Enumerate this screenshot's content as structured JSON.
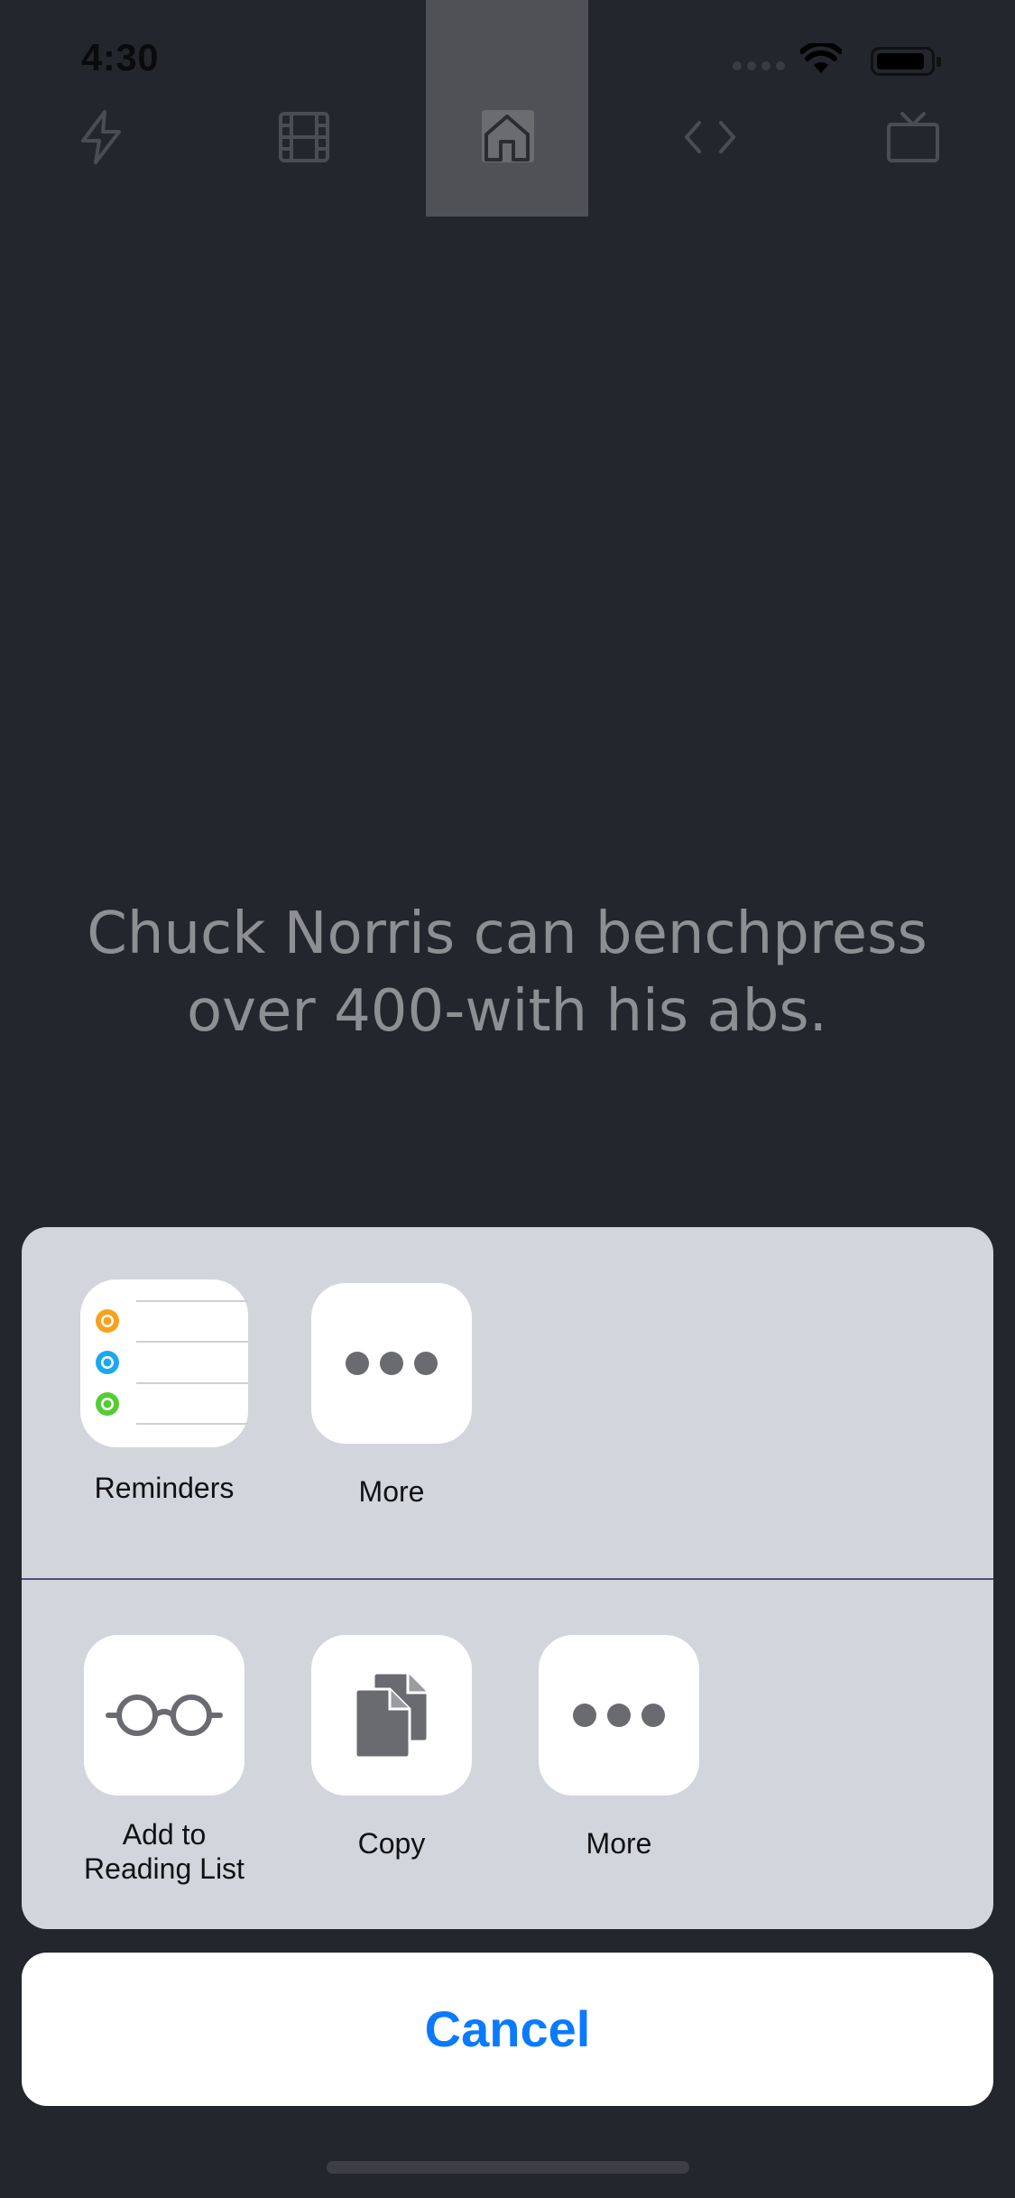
{
  "status_bar": {
    "time": "4:30"
  },
  "tabs": [
    {
      "icon": "lightning-icon",
      "active": false
    },
    {
      "icon": "film-icon",
      "active": false
    },
    {
      "icon": "home-icon",
      "active": true
    },
    {
      "icon": "code-icon",
      "active": false
    },
    {
      "icon": "tv-icon",
      "active": false
    }
  ],
  "joke": {
    "text": "Chuck Norris can benchpress over 400-with his abs."
  },
  "share_sheet": {
    "apps": [
      {
        "label": "Reminders",
        "icon": "reminders-icon"
      },
      {
        "label": "More",
        "icon": "more-icon"
      }
    ],
    "actions": [
      {
        "label": "Add to\nReading List",
        "icon": "glasses-icon"
      },
      {
        "label": "Copy",
        "icon": "copy-icon"
      },
      {
        "label": "More",
        "icon": "more-icon"
      }
    ]
  },
  "cancel_label": "Cancel",
  "colors": {
    "accent": "#0a7aff",
    "background": "#24262d",
    "sheet": "#d2d5dc"
  }
}
